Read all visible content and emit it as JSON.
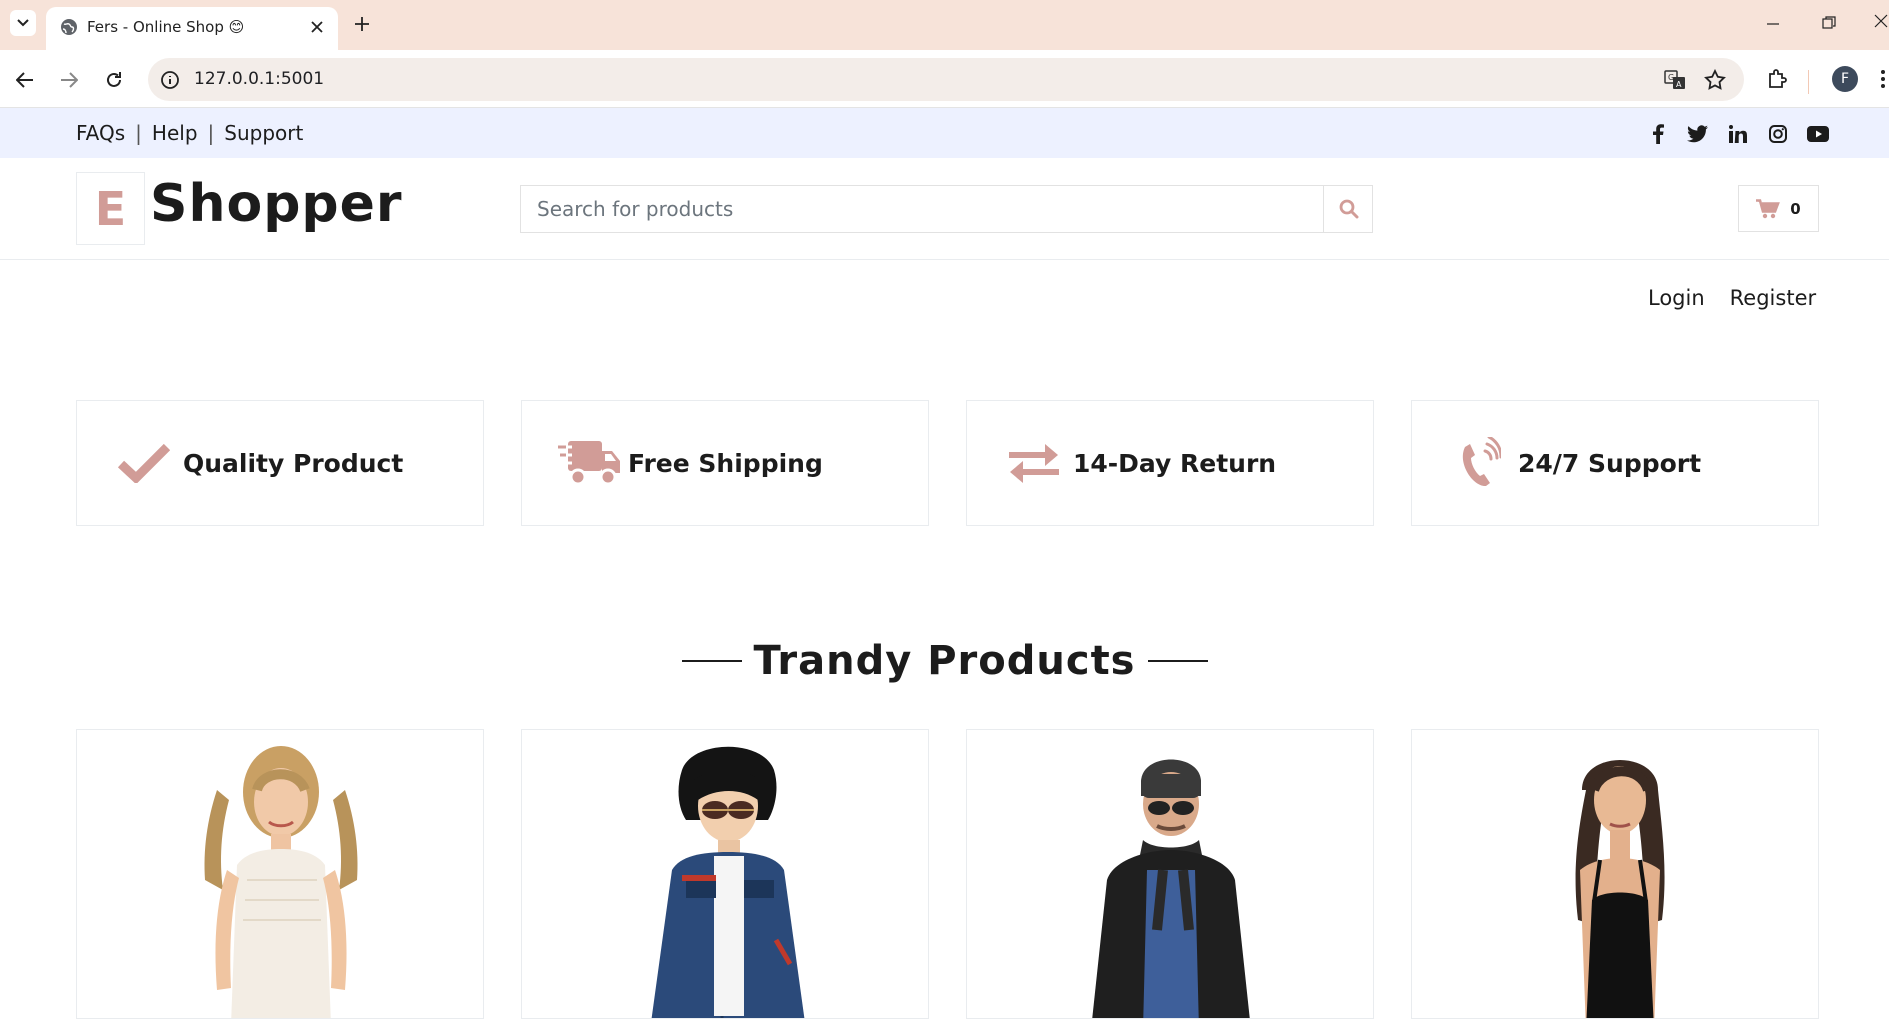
{
  "browser": {
    "tab_title": "Fers - Online Shop 😊",
    "url": "127.0.0.1:5001",
    "profile_initial": "F"
  },
  "topbar": {
    "links": [
      "FAQs",
      "Help",
      "Support"
    ],
    "separator": "|",
    "social_icons": [
      "facebook-icon",
      "twitter-icon",
      "linkedin-icon",
      "instagram-icon",
      "youtube-icon"
    ]
  },
  "header": {
    "logo_letter": "E",
    "logo_text": "Shopper",
    "search_placeholder": "Search for products",
    "cart_count": "0"
  },
  "auth": {
    "login": "Login",
    "register": "Register"
  },
  "features": [
    {
      "icon": "check-icon",
      "label": "Quality Product"
    },
    {
      "icon": "shipping-fast-icon",
      "label": "Free Shipping"
    },
    {
      "icon": "exchange-icon",
      "label": "14-Day Return"
    },
    {
      "icon": "phone-volume-icon",
      "label": "24/7 Support"
    }
  ],
  "section": {
    "title": "Trandy Products"
  },
  "products": [
    {
      "image": "woman-white-dress"
    },
    {
      "image": "boy-denim-jacket"
    },
    {
      "image": "man-leather-jacket"
    },
    {
      "image": "woman-black-top"
    }
  ],
  "colors": {
    "accent": "#D19C97",
    "topbar_bg": "#EDF1FF",
    "chrome_bg": "#F7E3D9",
    "text": "#1C1C1C"
  }
}
